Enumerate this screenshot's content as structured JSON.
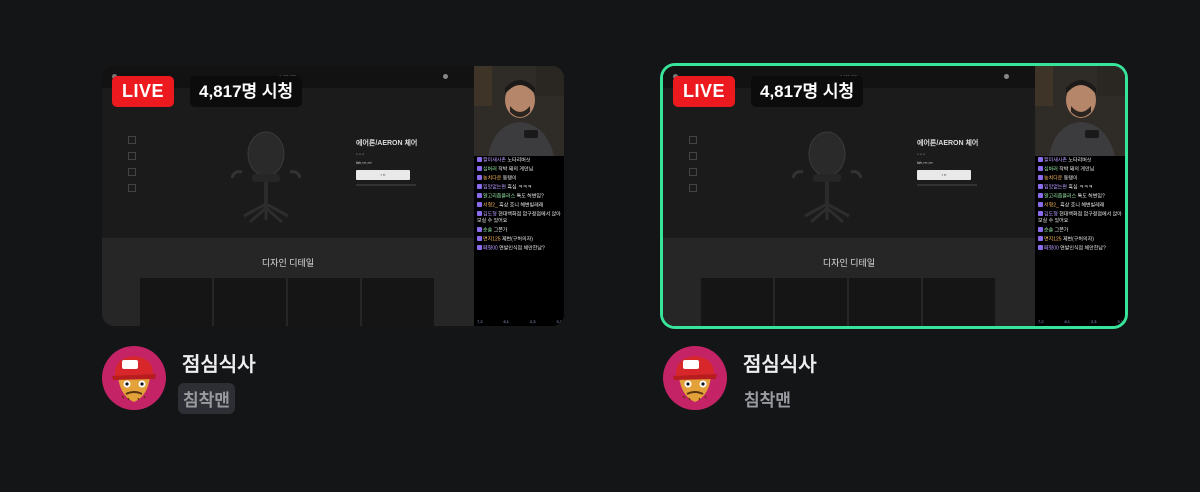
{
  "cards": [
    {
      "live_badge": "LIVE",
      "viewers": "4,817명 시청",
      "title": "점심식사",
      "channel": "침착맨",
      "selected": false,
      "channel_highlighted": true
    },
    {
      "live_badge": "LIVE",
      "viewers": "4,817명 시청",
      "title": "점심식사",
      "channel": "침착맨",
      "selected": true,
      "channel_highlighted": false
    }
  ],
  "stream_content": {
    "product_name": "에어론/AERON 체어",
    "section_title": "디자인 디테일",
    "chat": [
      {
        "user": "할미새사촌",
        "text": "노타리버싯"
      },
      {
        "user": "십버러",
        "text": "작박 돼의 게안님"
      },
      {
        "user": "농치다운",
        "text": "동탱이"
      },
      {
        "user": "입맛없는편",
        "text": "흑심 ㅋㅋㅋ"
      },
      {
        "user": "알고리즘플러스",
        "text": "톡도 허변임?"
      },
      {
        "user": "서형2_",
        "text": "흑상 호니 헤변빌레래"
      },
      {
        "user": "김도형",
        "text": "현대백화점 압구정점에서 앉아보실 수 있어요"
      },
      {
        "user": "순솔",
        "text": "그쯘가"
      },
      {
        "user": "면지125",
        "text": "제변(구허의자)"
      },
      {
        "user": "페형00",
        "text": "연발인식점 체안한남?"
      }
    ],
    "chat_footer": [
      "7,2",
      "6,1",
      "2,3",
      "3,1"
    ]
  },
  "colors": {
    "live_red": "#ec1a1f",
    "selected_border": "#38e39a",
    "background": "#141517"
  }
}
